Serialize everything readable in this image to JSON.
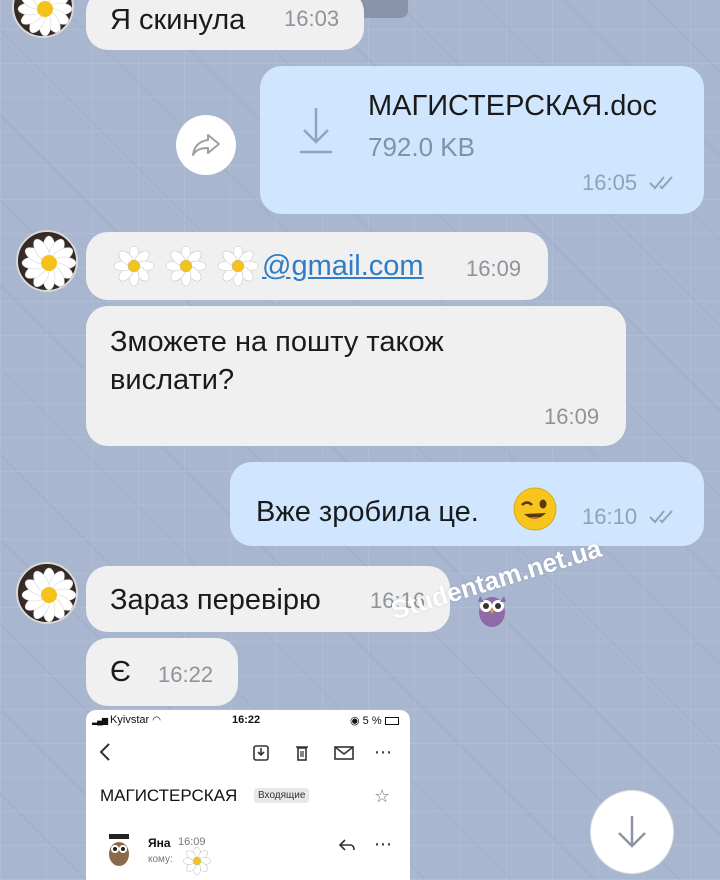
{
  "messages": {
    "m1": {
      "text": "Я скинула",
      "time": "16:03"
    },
    "file": {
      "name": "МАГИСТЕРСКАЯ.doc",
      "size": "792.0 KB",
      "time": "16:05"
    },
    "email": {
      "text": "@gmail.com",
      "time": "16:09"
    },
    "m2": {
      "line1": "Зможете на пошту також",
      "line2": "вислати?",
      "time": "16:09"
    },
    "m3": {
      "text": "Вже зробила це.",
      "time": "16:10"
    },
    "m4": {
      "text": "Зараз перевірю",
      "time": "16:16"
    },
    "m5": {
      "text": "Є",
      "time": "16:22"
    }
  },
  "watermark": {
    "text": "Studentam.net.ua"
  },
  "screenshot_preview": {
    "carrier": "Kyivstar",
    "clock": "16:22",
    "battery": "5 %",
    "subject": "МАГИСТЕРСКАЯ",
    "folder_badge": "Входящие",
    "sender": "Яна",
    "sender_time": "16:09",
    "to_label": "кому:"
  },
  "colors": {
    "incoming_bubble": "#f0f0f0",
    "outgoing_bubble": "#cfe6fe",
    "link": "#2f7dc6",
    "background": "#a9b6cf"
  },
  "icons": [
    "forward-icon",
    "download-icon",
    "double-check-icon",
    "wink-emoji-icon",
    "owl-icon",
    "arrow-down-icon",
    "back-icon",
    "archive-icon",
    "trash-icon",
    "mail-icon",
    "more-icon",
    "star-icon",
    "reply-icon",
    "daisy-avatar"
  ]
}
